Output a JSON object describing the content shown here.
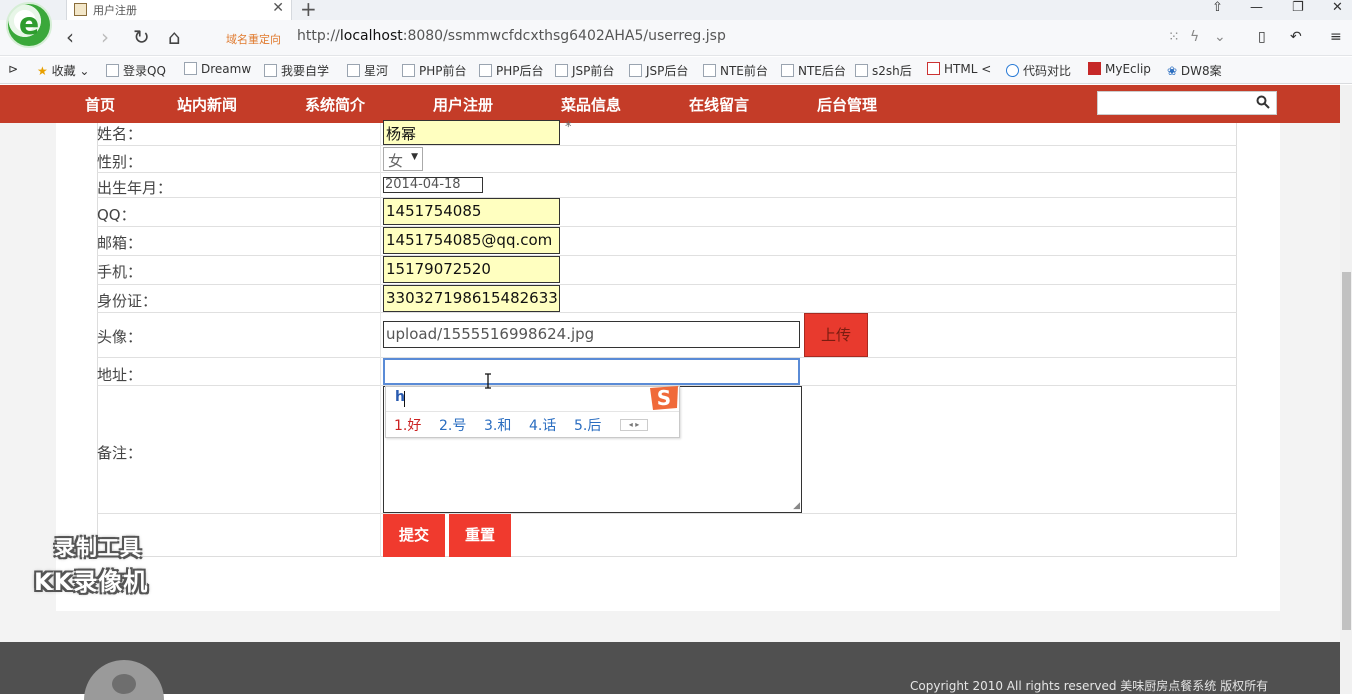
{
  "browser": {
    "tab_title": "用户注册",
    "new_tab": "+",
    "close": "✕",
    "redirect_label": "域名重定向",
    "url_prefix": "http://",
    "url_host": "localhost",
    "url_rest": ":8080/ssmmwcfdcxthsg6402AHA5/userreg.jsp",
    "bookmarks": [
      "收藏",
      "登录QQ",
      "Dreamw",
      "我要自学",
      "星河",
      "PHP前台",
      "PHP后台",
      "JSP前台",
      "JSP后台",
      "NTE前台",
      "NTE后台",
      "s2sh后",
      "HTML <",
      "代码对比",
      "MyEclip",
      "DW8案"
    ]
  },
  "site_nav": {
    "items": [
      "首页",
      "站内新闻",
      "系统简介",
      "用户注册",
      "菜品信息",
      "在线留言",
      "后台管理"
    ]
  },
  "form": {
    "name_label": "姓名：",
    "name_value": "杨幂",
    "required_mark": "*",
    "sex_label": "性别：",
    "sex_value": "女",
    "birth_label": "出生年月：",
    "birth_value": "2014-04-18",
    "qq_label": "QQ：",
    "qq_value": "1451754085",
    "email_label": "邮箱：",
    "email_value": "1451754085@qq.com",
    "phone_label": "手机：",
    "phone_value": "15179072520",
    "id_label": "身份证：",
    "id_value": "330327198615482633",
    "avatar_label": "头像：",
    "avatar_value": "upload/1555516998624.jpg",
    "upload_label": "上传",
    "address_label": "地址：",
    "notes_label": "备注：",
    "submit_label": "提交",
    "reset_label": "重置"
  },
  "ime": {
    "input": "h",
    "candidates": [
      "1.好",
      "2.号",
      "3.和",
      "4.话",
      "5.后"
    ]
  },
  "watermark": {
    "line1": "录制工具",
    "line2": "KK录像机"
  },
  "footer": {
    "copyright": "Copyright 2010 All rights reserved 美味厨房点餐系统 版权所有"
  },
  "colors": {
    "nav_red": "#c43c28",
    "button_red": "#f03a2e",
    "input_yellow": "#ffffc0"
  }
}
